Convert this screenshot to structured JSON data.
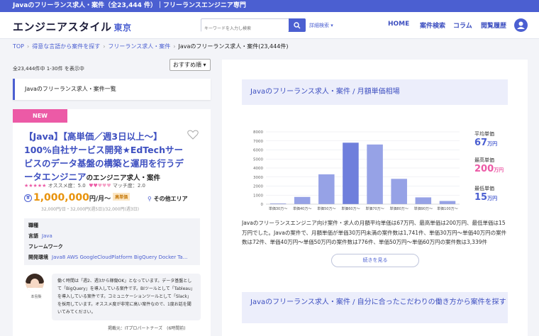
{
  "topbar": {
    "text": "Javaのフリーランス求人・案件（全23,444 件）｜フリーランスエンジニア専門"
  },
  "header": {
    "logo": "エンジニアスタイル",
    "logo_sub": "東京",
    "search_placeholder": "キーワードを入力し検索",
    "advanced_search": "詳細検索 ▾",
    "nav": [
      "HOME",
      "案件検索",
      "コラム",
      "閲覧履歴"
    ]
  },
  "breadcrumb": {
    "items": [
      "TOP",
      "得意な言語から案件を探す",
      "フリーランス求人・案件",
      "Javaのフリーランス求人・案件(23,444件)"
    ]
  },
  "listing": {
    "count_text": "全23,444件中 1-30件 を表示中",
    "sort_value": "おすすめ順 ▾",
    "list_title": "Javaのフリーランス求人・案件一覧"
  },
  "job": {
    "badge": "NEW",
    "title": "【Java】【高単価／週3日以上〜】100%自社サービス開発★EdTechサービスのデータ基盤の構築と運用を行うデータエンジニア",
    "title_tail": "のエンジニア求人・案件",
    "rating_text": "オススメ度：5.0",
    "match_text": "マッチ度：2.0",
    "salary": "1,000,000",
    "salary_unit": "円/月〜",
    "salary_badge": "高単価",
    "area": "その他エリア",
    "sub_salary": "32,000円/日・32,000円(週5日)/32,000円(週3日)",
    "spec": {
      "occupation_label": "職種",
      "language_label": "言語",
      "language_value": "Java",
      "framework_label": "フレームワーク",
      "env_label": "開発環境",
      "env_value": "Java8 AWS GoogleCloudPlatform BigQuery Docker Ta..."
    },
    "agent_name": "本島梨",
    "comment": "働く時間は「週2、週3から稼働OK」となっています。データ基盤として「BigQuery」を導入している案件です。BIツールとして「Tableau」を導入している案件です。コミュニケーションツールとして「Slack」を採用しています。オススメ度が非常に高い案件なので、1度お話を聞いてみてください。",
    "posted": "掲載元：ITプロパートナーズ　(6時間前)"
  },
  "market": {
    "title": "Javaのフリーランス求人・案件 / 月額単価相場",
    "stats": [
      {
        "label": "平均単価",
        "value": "67",
        "unit": "万円",
        "color": "#4b5fd1"
      },
      {
        "label": "最高単価",
        "value": "200",
        "unit": "万円",
        "color": "#ec5aa6"
      },
      {
        "label": "最低単価",
        "value": "15",
        "unit": "万円",
        "color": "#4b5fd1"
      }
    ],
    "description": "Javaのフリーランスエンジニア向け案件・求人の月額平均単価は67万円、最高単価は200万円、最低単価は15万円でした。Javaの案件で、月額単価が単価30万円未満の案件数は1,741件、単価30万円〜単価40万円の案件数は72件、単価40万円〜単価50万円の案件数は776件、単価50万円〜単価60万円の案件数は3,339件",
    "more_button": "続きを見る",
    "second_title": "Javaのフリーランス求人・案件 / 自分に合ったこだわりの働き方から案件を探す"
  },
  "chart_data": {
    "type": "bar",
    "categories": [
      "単価30万〜",
      "単価40万〜",
      "単価50万〜",
      "単価60万〜",
      "単価70万〜",
      "単価80万〜",
      "単価90万〜",
      "単価100万〜"
    ],
    "values": [
      80,
      800,
      3300,
      6800,
      6600,
      2800,
      750,
      350
    ],
    "ylim": [
      0,
      8000
    ],
    "yticks": [
      0,
      1000,
      2000,
      3000,
      4000,
      5000,
      6000,
      7000,
      8000
    ],
    "grid": true,
    "colors": {
      "bar": "#96a2e6",
      "peak": "#6f7fdc"
    }
  }
}
